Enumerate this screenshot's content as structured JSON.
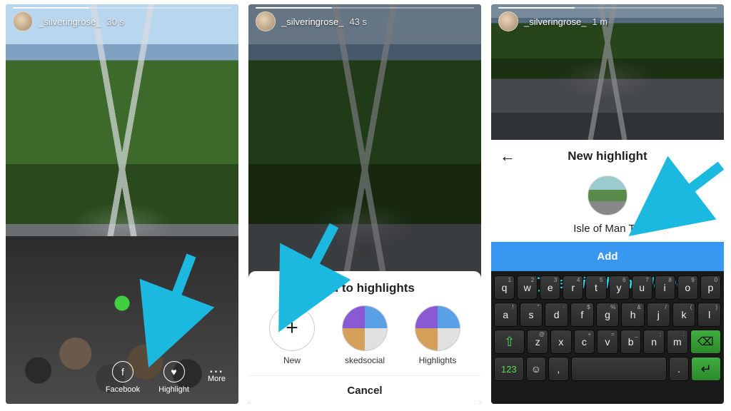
{
  "screen1": {
    "username": "_silveringrose_",
    "timestamp": "30 s",
    "actions": {
      "facebook": "Facebook",
      "highlight": "Highlight",
      "more": "More"
    }
  },
  "screen2": {
    "username": "_silveringrose_",
    "timestamp": "43 s",
    "sheet_title": "Add to highlights",
    "items": {
      "new": "New",
      "sked": "skedsocial",
      "hl": "Highlights"
    },
    "cancel": "Cancel"
  },
  "screen3": {
    "username": "_silveringrose_",
    "timestamp": "1 m",
    "panel_title": "New highlight",
    "highlight_name": "Isle of Man TT",
    "add_button": "Add",
    "overlay": "Type Highlight Name",
    "keyboard": {
      "row1": [
        "q",
        "w",
        "e",
        "r",
        "t",
        "y",
        "u",
        "i",
        "o",
        "p"
      ],
      "row1_alt": [
        "1",
        "2",
        "3",
        "4",
        "5",
        "6",
        "7",
        "8",
        "9",
        "0"
      ],
      "row2": [
        "a",
        "s",
        "d",
        "f",
        "g",
        "h",
        "j",
        "k",
        "l"
      ],
      "row2_alt": [
        "!",
        "\"",
        "·",
        "$",
        "%",
        "&",
        "/",
        "(",
        ")"
      ],
      "row3": [
        "z",
        "x",
        "c",
        "v",
        "b",
        "n",
        "m"
      ],
      "row3_alt": [
        "@",
        "",
        "+",
        "=",
        "_",
        ";",
        ":"
      ],
      "num_label": "123",
      "shift": "⇧",
      "backspace": "⌫",
      "enter": "↵",
      "emoji": "☺",
      "comma": ",",
      "period": "."
    }
  },
  "arrow_color": "#1bb8e0"
}
